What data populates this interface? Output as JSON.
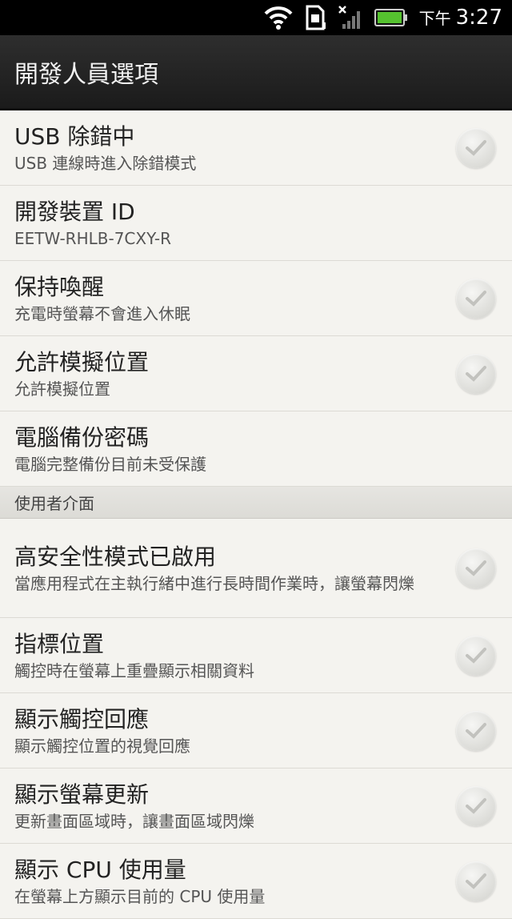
{
  "status_bar": {
    "ampm": "下午",
    "time": "3:27",
    "icons": [
      "wifi-icon",
      "sim-card-icon",
      "no-signal-icon",
      "battery-icon"
    ],
    "battery_color": "#55c22f"
  },
  "header": {
    "title": "開發人員選項"
  },
  "items": [
    {
      "title": "USB 除錯中",
      "summary": "USB 連線時進入除錯模式",
      "has_check": true
    },
    {
      "title": "開發裝置 ID",
      "summary": "EETW-RHLB-7CXY-R",
      "has_check": false
    },
    {
      "title": "保持喚醒",
      "summary": "充電時螢幕不會進入休眠",
      "has_check": true
    },
    {
      "title": "允許模擬位置",
      "summary": "允許模擬位置",
      "has_check": true
    },
    {
      "title": "電腦備份密碼",
      "summary": "電腦完整備份目前未受保護",
      "has_check": false
    }
  ],
  "section": {
    "label": "使用者介面"
  },
  "ui_items": [
    {
      "title": "高安全性模式已啟用",
      "summary": "當應用程式在主執行緒中進行長時間作業時，讓螢幕閃爍",
      "has_check": true
    },
    {
      "title": "指標位置",
      "summary": "觸控時在螢幕上重疊顯示相關資料",
      "has_check": true
    },
    {
      "title": "顯示觸控回應",
      "summary": "顯示觸控位置的視覺回應",
      "has_check": true
    },
    {
      "title": "顯示螢幕更新",
      "summary": "更新畫面區域時，讓畫面區域閃爍",
      "has_check": true
    },
    {
      "title": "顯示 CPU 使用量",
      "summary": "在螢幕上方顯示目前的 CPU 使用量",
      "has_check": true
    }
  ]
}
